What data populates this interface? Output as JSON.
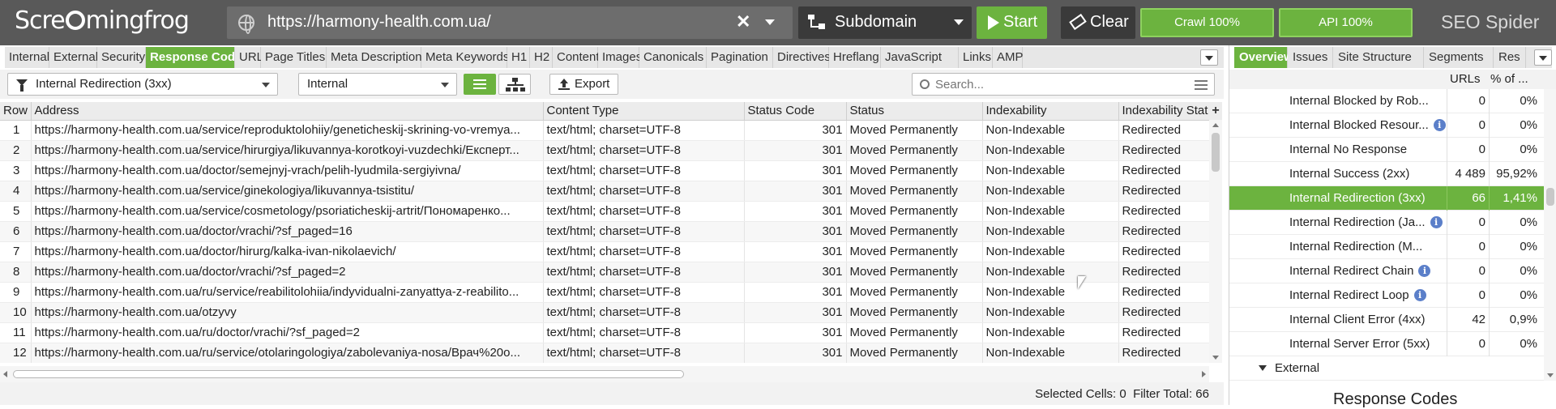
{
  "app": {
    "logo_part1": "Scre",
    "logo_part2": "mingfrog",
    "product": "SEO Spider"
  },
  "topbar": {
    "url": "https://harmony-health.com.ua/",
    "mode": "Subdomain",
    "start_label": "Start",
    "clear_label": "Clear",
    "crawl_label": "Crawl 100%",
    "api_label": "API 100%",
    "crawl_progress": 1.0,
    "api_progress": 1.0
  },
  "tabs": [
    "Internal",
    "External",
    "Security",
    "Response Codes",
    "URL",
    "Page Titles",
    "Meta Description",
    "Meta Keywords",
    "H1",
    "H2",
    "Content",
    "Images",
    "Canonicals",
    "Pagination",
    "Directives",
    "Hreflang",
    "JavaScript",
    "Links",
    "AMP"
  ],
  "active_tab": "Response Codes",
  "filterbar": {
    "filter": "Internal Redirection (3xx)",
    "scope": "Internal",
    "export_label": "Export",
    "search_placeholder": "Search..."
  },
  "table": {
    "columns": [
      "Row",
      "Address",
      "Content Type",
      "Status Code",
      "Status",
      "Indexability",
      "Indexability Stat"
    ],
    "rows": [
      [
        "1",
        "https://harmony-health.com.ua/service/reproduktolohiiy/geneticheskij-skrining-vo-vremya...",
        "text/html; charset=UTF-8",
        "301",
        "Moved Permanently",
        "Non-Indexable",
        "Redirected"
      ],
      [
        "2",
        "https://harmony-health.com.ua/service/hirurgiya/likuvannya-korotkoyi-vuzdechki/Експерт...",
        "text/html; charset=UTF-8",
        "301",
        "Moved Permanently",
        "Non-Indexable",
        "Redirected"
      ],
      [
        "3",
        "https://harmony-health.com.ua/doctor/semejnyj-vrach/pelih-lyudmila-sergiyivna/",
        "text/html; charset=UTF-8",
        "301",
        "Moved Permanently",
        "Non-Indexable",
        "Redirected"
      ],
      [
        "4",
        "https://harmony-health.com.ua/service/ginekologiya/likuvannya-tsistitu/",
        "text/html; charset=UTF-8",
        "301",
        "Moved Permanently",
        "Non-Indexable",
        "Redirected"
      ],
      [
        "5",
        "https://harmony-health.com.ua/service/cosmetology/psoriaticheskij-artrit/Пономаренко...",
        "text/html; charset=UTF-8",
        "301",
        "Moved Permanently",
        "Non-Indexable",
        "Redirected"
      ],
      [
        "6",
        "https://harmony-health.com.ua/doctor/vrachi/?sf_paged=16",
        "text/html; charset=UTF-8",
        "301",
        "Moved Permanently",
        "Non-Indexable",
        "Redirected"
      ],
      [
        "7",
        "https://harmony-health.com.ua/doctor/hirurg/kalka-ivan-nikolaevich/",
        "text/html; charset=UTF-8",
        "301",
        "Moved Permanently",
        "Non-Indexable",
        "Redirected"
      ],
      [
        "8",
        "https://harmony-health.com.ua/doctor/vrachi/?sf_paged=2",
        "text/html; charset=UTF-8",
        "301",
        "Moved Permanently",
        "Non-Indexable",
        "Redirected"
      ],
      [
        "9",
        "https://harmony-health.com.ua/ru/service/reabilitolohiia/indyvidualni-zanyattya-z-reabilito...",
        "text/html; charset=UTF-8",
        "301",
        "Moved Permanently",
        "Non-Indexable",
        "Redirected"
      ],
      [
        "10",
        "https://harmony-health.com.ua/otzyvy",
        "text/html; charset=UTF-8",
        "301",
        "Moved Permanently",
        "Non-Indexable",
        "Redirected"
      ],
      [
        "11",
        "https://harmony-health.com.ua/ru/doctor/vrachi/?sf_paged=2",
        "text/html; charset=UTF-8",
        "301",
        "Moved Permanently",
        "Non-Indexable",
        "Redirected"
      ],
      [
        "12",
        "https://harmony-health.com.ua/ru/service/otolaringologiya/zabolevaniya-nosa/Врач%20о...",
        "text/html; charset=UTF-8",
        "301",
        "Moved Permanently",
        "Non-Indexable",
        "Redirected"
      ]
    ]
  },
  "statusbar": {
    "selected_cells": "Selected Cells:  0",
    "filter_total": "Filter Total:  66"
  },
  "right_panel": {
    "tabs": [
      "Overview",
      "Issues",
      "Site Structure",
      "Segments",
      "Res"
    ],
    "active_tab": "Overview",
    "col_urls": "URLs",
    "col_pct": "% of ...",
    "rows": [
      {
        "label": "Internal Blocked by Rob...",
        "urls": "0",
        "pct": "0%",
        "info": false,
        "selected": false
      },
      {
        "label": "Internal Blocked Resour...",
        "urls": "0",
        "pct": "0%",
        "info": true,
        "selected": false
      },
      {
        "label": "Internal No Response",
        "urls": "0",
        "pct": "0%",
        "info": false,
        "selected": false
      },
      {
        "label": "Internal Success (2xx)",
        "urls": "4 489",
        "pct": "95,92%",
        "info": false,
        "selected": false
      },
      {
        "label": "Internal Redirection (3xx)",
        "urls": "66",
        "pct": "1,41%",
        "info": false,
        "selected": true
      },
      {
        "label": "Internal Redirection (Ja...",
        "urls": "0",
        "pct": "0%",
        "info": true,
        "selected": false
      },
      {
        "label": "Internal Redirection (M...",
        "urls": "0",
        "pct": "0%",
        "info": false,
        "selected": false
      },
      {
        "label": "Internal Redirect Chain",
        "urls": "0",
        "pct": "0%",
        "info": true,
        "selected": false
      },
      {
        "label": "Internal Redirect Loop",
        "urls": "0",
        "pct": "0%",
        "info": true,
        "selected": false
      },
      {
        "label": "Internal Client Error (4xx)",
        "urls": "42",
        "pct": "0,9%",
        "info": false,
        "selected": false
      },
      {
        "label": "Internal Server Error (5xx)",
        "urls": "0",
        "pct": "0%",
        "info": false,
        "selected": false
      }
    ],
    "group_label": "External",
    "chart_title": "Response Codes"
  },
  "colors": {
    "accent_green": "#6cb33f",
    "topbar": "#595959",
    "info_icon": "#5b7fc9"
  }
}
